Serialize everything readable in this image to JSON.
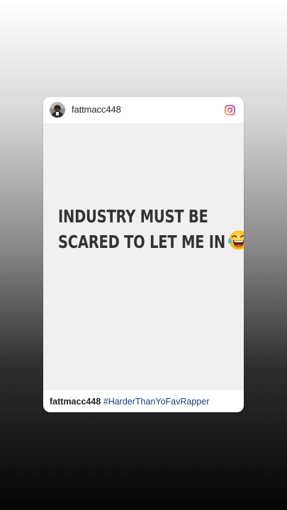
{
  "post": {
    "username": "fattmacc448",
    "text_line1": "INDUSTRY MUST BE",
    "text_line2": "SCARED TO LET ME IN",
    "emoji": "face-with-tears-of-joy",
    "caption_user": "fattmacc448",
    "caption_hashtag": "#HarderThanYoFavRapper"
  },
  "icons": {
    "platform": "instagram-icon",
    "avatar": "profile-avatar"
  },
  "colors": {
    "hashtag": "#1b3d73",
    "post_background": "#f0f0f0",
    "instagram_gradient": [
      "#f9a13a",
      "#e1306c",
      "#833ab4"
    ]
  }
}
